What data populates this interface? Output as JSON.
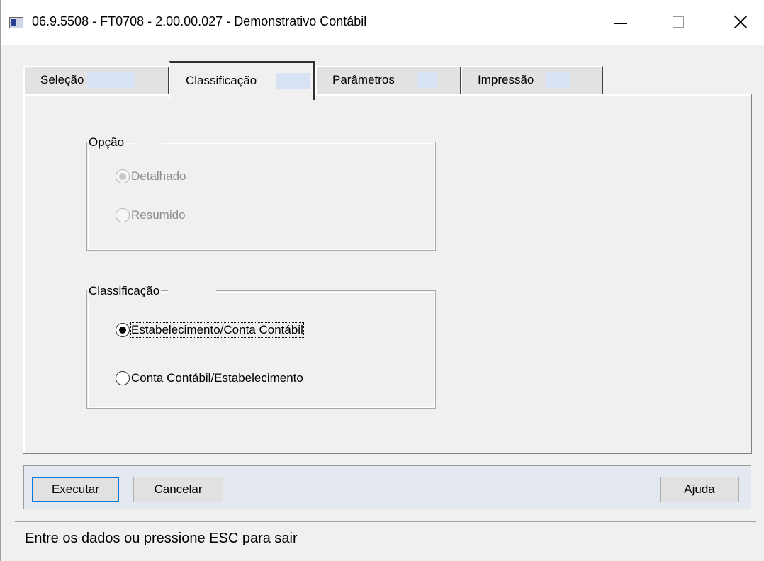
{
  "window": {
    "title": "06.9.5508 - FT0708 - 2.00.00.027 - Demonstrativo Contábil"
  },
  "tabs": [
    {
      "label": "Seleção"
    },
    {
      "label": "Classificação"
    },
    {
      "label": "Parâmetros"
    },
    {
      "label": "Impressão"
    }
  ],
  "active_tab": "Classificação",
  "opcao_group": {
    "title": "Opção",
    "options": [
      {
        "label": "Detalhado",
        "selected": true,
        "enabled": false
      },
      {
        "label": "Resumido",
        "selected": false,
        "enabled": false
      }
    ]
  },
  "classificacao_group": {
    "title": "Classificação",
    "options": [
      {
        "label": "Estabelecimento/Conta Contábil",
        "selected": true,
        "enabled": true
      },
      {
        "label": "Conta Contábil/Estabelecimento",
        "selected": false,
        "enabled": true
      }
    ]
  },
  "buttons": {
    "executar": "Executar",
    "cancelar": "Cancelar",
    "ajuda": "Ajuda"
  },
  "status": "Entre os dados ou pressione ESC para sair",
  "icons": {
    "app": "app-window-icon",
    "minimize": "minimize-icon",
    "maximize": "maximize-icon",
    "close": "close-icon"
  },
  "colors": {
    "tab_highlight": "#d7e2f5",
    "button_bar": "#e4e8f0",
    "default_button_border": "#0078d7"
  }
}
